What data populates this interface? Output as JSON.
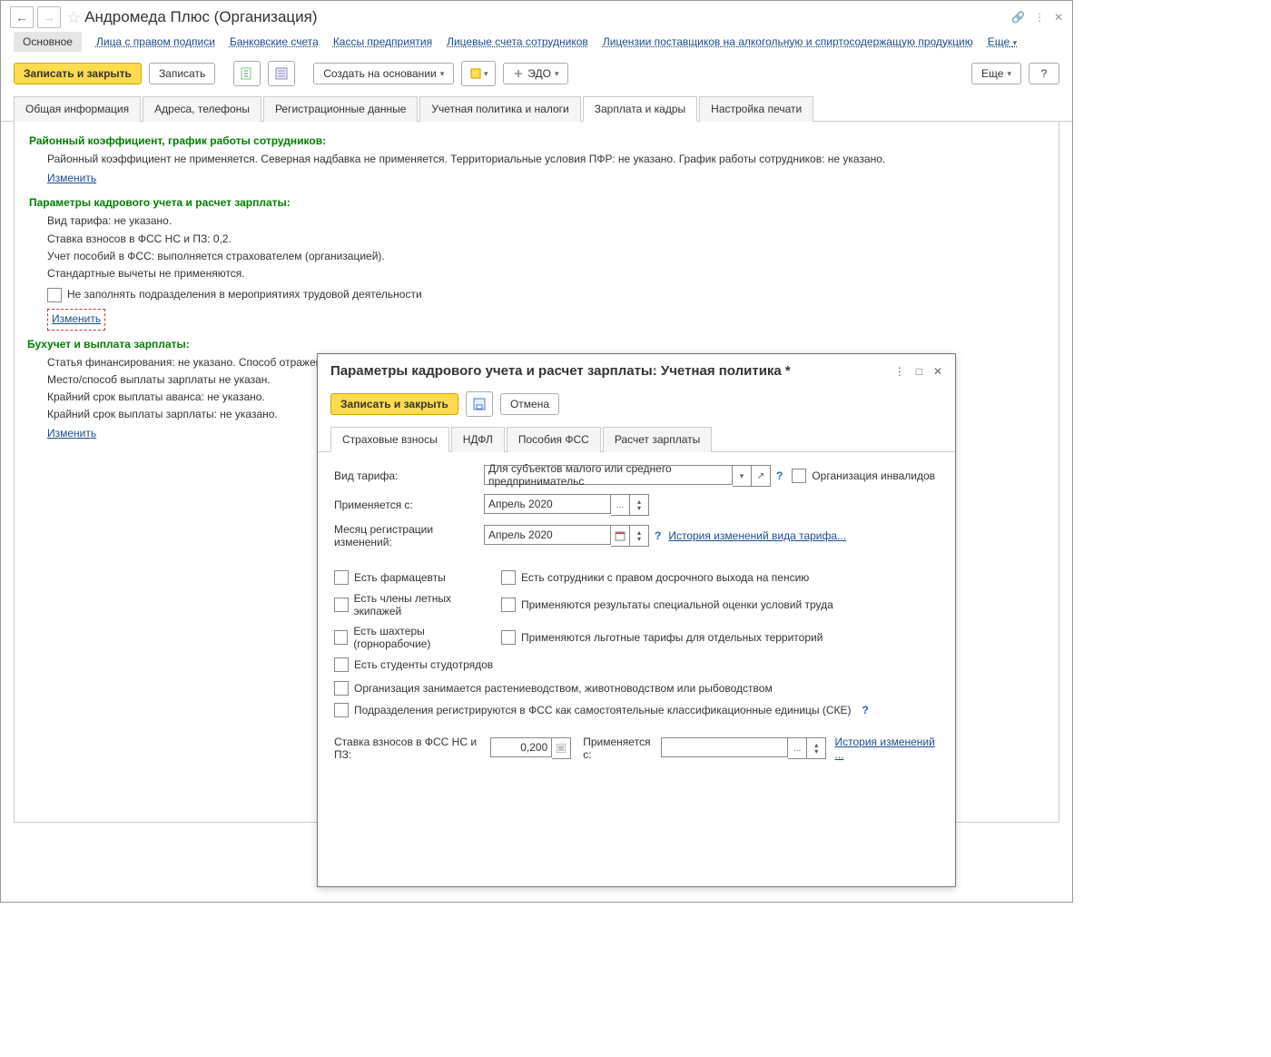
{
  "header": {
    "title": "Андромеда Плюс (Организация)",
    "tab_main": "Основное",
    "links": [
      "Лица с правом подписи",
      "Банковские счета",
      "Кассы предприятия",
      "Лицевые счета сотрудников",
      "Лицензии поставщиков на алкогольную и спиртосодержащую продукцию"
    ],
    "more": "Еще"
  },
  "toolbar": {
    "save_close": "Записать и закрыть",
    "save": "Записать",
    "create_based": "Создать на основании",
    "edo": "ЭДО",
    "more": "Еще",
    "help": "?"
  },
  "tabs": [
    "Общая информация",
    "Адреса, телефоны",
    "Регистрационные данные",
    "Учетная политика и налоги",
    "Зарплата и кадры",
    "Настройка печати"
  ],
  "active_tab_index": 4,
  "sections": {
    "s1": {
      "title": "Районный коэффициент, график работы сотрудников:",
      "text": "Районный коэффициент не применяется. Северная надбавка не применяется. Территориальные условия ПФР: не указано. График работы сотрудников: не указано.",
      "edit": "Изменить"
    },
    "s2": {
      "title": "Параметры кадрового учета и расчет зарплаты:",
      "l1": "Вид тарифа: не указано.",
      "l2": " Ставка взносов в ФСС НС и ПЗ: 0,2.",
      "l3": "Учет пособий в ФСС: выполняется страхователем (организацией).",
      "l4": "Стандартные вычеты не применяются.",
      "cb_label": "Не заполнять подразделения в мероприятиях трудовой деятельности",
      "edit": "Изменить"
    },
    "s3": {
      "title": "Бухучет и выплата зарплаты:",
      "l1": "Статья финансирования: не указано. Способ отражения зарплаты в бухучете: не указано. Отношение к ЕНВД: не указано..",
      "l2": "Место/способ выплаты зарплаты не указан.",
      "l3": "Крайний срок выплаты аванса: не указано.",
      "l4": "Крайний срок выплаты зарплаты: не указано.",
      "edit": "Изменить"
    }
  },
  "dialog": {
    "title": "Параметры кадрового учета и расчет зарплаты: Учетная политика *",
    "save_close": "Записать и закрыть",
    "cancel": "Отмена",
    "tabs": [
      "Страховые взносы",
      "НДФЛ",
      "Пособия ФСС",
      "Расчет зарплаты"
    ],
    "active_tab_index": 0,
    "form": {
      "tariff_label": "Вид тарифа:",
      "tariff_value": "Для субъектов малого или среднего предпринимательс",
      "org_invalid": "Организация инвалидов",
      "from_label": "Применяется с:",
      "from_value": "Апрель 2020",
      "month_label": "Месяц регистрации изменений:",
      "month_value": "Апрель 2020",
      "history_link": "История изменений вида тарифа...",
      "cb_pharm": "Есть фармацевты",
      "cb_pension": "Есть сотрудники с правом досрочного выхода на пенсию",
      "cb_flight": "Есть члены летных экипажей",
      "cb_sout": "Применяются результаты специальной оценки условий труда",
      "cb_miners": "Есть шахтеры (горнорабочие)",
      "cb_territory": "Применяются льготные тарифы для отдельных территорий",
      "cb_students": "Есть студенты студотрядов",
      "cb_agro": "Организация занимается растениеводством, животноводством или рыбоводством",
      "cb_fss_ske": "Подразделения регистрируются в ФСС как самостоятельные классификационные единицы (СКЕ)",
      "rate_label": "Ставка взносов в ФСС НС и ПЗ:",
      "rate_value": "0,200",
      "rate_from_label": "Применяется с:",
      "rate_from_value": "",
      "rate_history": "История изменений ..."
    }
  }
}
